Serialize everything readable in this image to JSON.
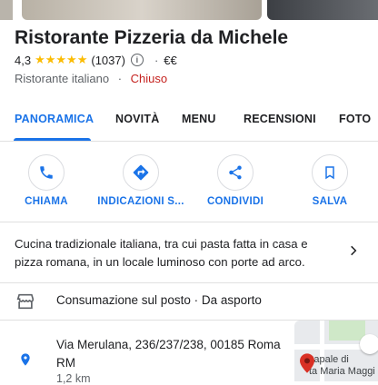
{
  "place": {
    "name": "Ristorante Pizzeria da Michele",
    "rating": "4,3",
    "stars": "★★★★★",
    "reviews_count": "(1037)",
    "price": "€€",
    "category": "Ristorante italiano",
    "status": "Chiuso"
  },
  "tabs": [
    "PANORAMICA",
    "NOVITÀ",
    "MENU",
    "RECENSIONI",
    "FOTO"
  ],
  "actions": [
    {
      "label": "CHIAMA",
      "icon": "phone-icon"
    },
    {
      "label": "INDICAZIONI S...",
      "icon": "directions-icon"
    },
    {
      "label": "CONDIVIDI",
      "icon": "share-icon"
    },
    {
      "label": "SALVA",
      "icon": "bookmark-icon"
    }
  ],
  "description": "Cucina tradizionale italiana, tra cui pasta fatta in casa e pizza romana, in un locale luminoso con porte ad arco.",
  "services": "Consumazione sul posto · Da asporto",
  "address": {
    "text": "Via Merulana, 236/237/238, 00185 Roma RM",
    "distance": "1,2 km"
  },
  "map": {
    "label_1": "Papale di",
    "label_2": "ta Maria Maggi"
  },
  "colors": {
    "accent": "#1a73e8",
    "star": "#fbbc04",
    "closed": "#c5221f",
    "pin": "#d93025"
  }
}
